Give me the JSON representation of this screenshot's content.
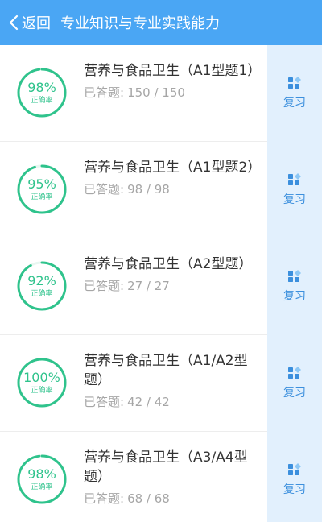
{
  "header": {
    "back_label": "返回",
    "title": "专业知识与专业实践能力",
    "bg_color": "#4aa6f4"
  },
  "accent_green": "#2fc38c",
  "review_color": "#3b8fdd",
  "items": [
    {
      "percent_text": "98%",
      "percent": 98,
      "rate_label": "正确率",
      "title": "营养与食品卫生（A1型题1）",
      "answered_label": "已答题:",
      "answered_value": "150 / 150",
      "review_label": "复习"
    },
    {
      "percent_text": "95%",
      "percent": 95,
      "rate_label": "正确率",
      "title": "营养与食品卫生（A1型题2）",
      "answered_label": "已答题:",
      "answered_value": "98 / 98",
      "review_label": "复习"
    },
    {
      "percent_text": "92%",
      "percent": 92,
      "rate_label": "正确率",
      "title": "营养与食品卫生（A2型题）",
      "answered_label": "已答题:",
      "answered_value": "27 / 27",
      "review_label": "复习"
    },
    {
      "percent_text": "100%",
      "percent": 100,
      "rate_label": "正确率",
      "title": "营养与食品卫生（A1/A2型题）",
      "answered_label": "已答题:",
      "answered_value": "42 / 42",
      "review_label": "复习"
    },
    {
      "percent_text": "98%",
      "percent": 98,
      "rate_label": "正确率",
      "title": "营养与食品卫生（A3/A4型题）",
      "answered_label": "已答题:",
      "answered_value": "68 / 68",
      "review_label": "复习"
    }
  ]
}
